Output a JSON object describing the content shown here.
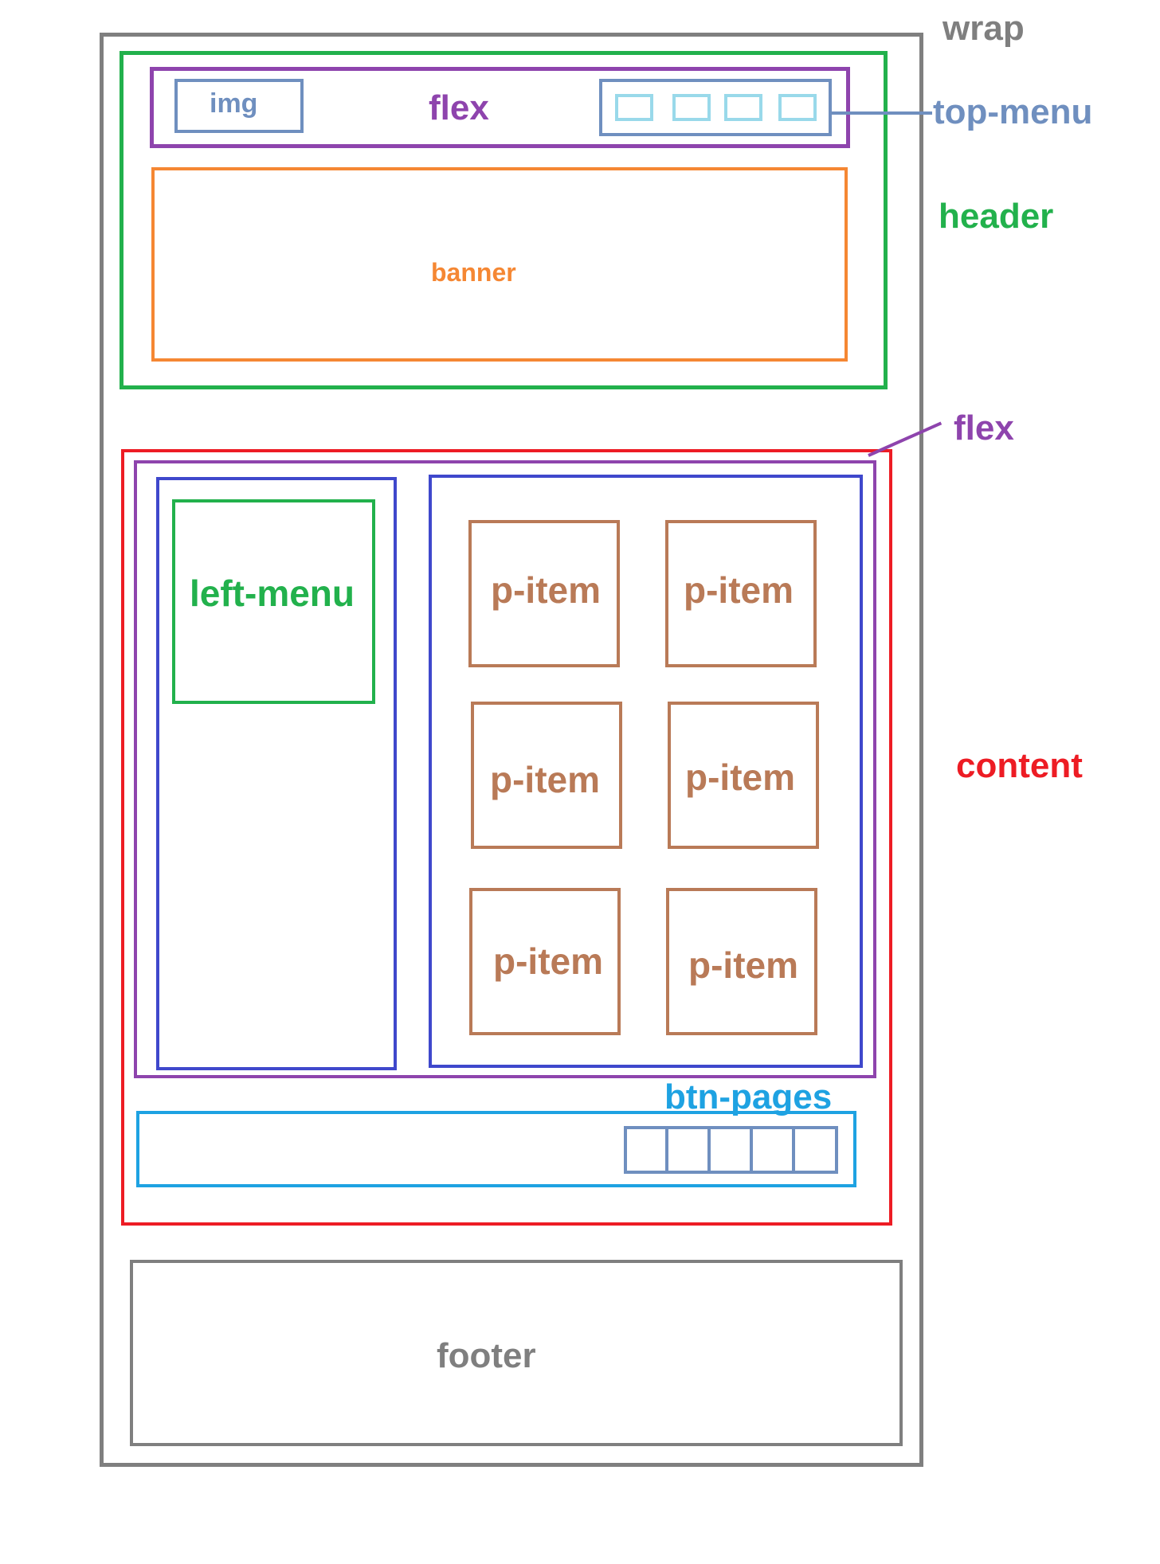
{
  "labels": {
    "wrap": "wrap",
    "header": "header",
    "top_flex": "flex",
    "img": "img",
    "top_menu": "top-menu",
    "banner": "banner",
    "content_flex": "flex",
    "left_menu": "left-menu",
    "content": "content",
    "btn_pages": "btn-pages",
    "footer": "footer"
  },
  "p_items": [
    "p-item",
    "p-item",
    "p-item",
    "p-item",
    "p-item",
    "p-item"
  ],
  "colors": {
    "wrap": "#7f7f7f",
    "header": "#22b14c",
    "flex": "#8e44ad",
    "top_menu": "#6f8fbf",
    "top_menu_items": "#99d9ea",
    "banner": "#f58733",
    "content": "#ed1c24",
    "columns": "#3f48cc",
    "p_item": "#b97a57",
    "btn_pages": "#1ea2e2",
    "footer": "#7f7f7f"
  }
}
